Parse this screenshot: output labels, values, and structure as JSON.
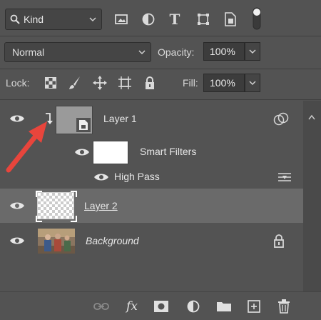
{
  "filter": {
    "kind_label": "Kind",
    "icons": [
      "pixel-filter-icon",
      "adjustment-filter-icon",
      "type-filter-icon",
      "shape-filter-icon",
      "smart-object-filter-icon",
      "filter-toggle-icon"
    ]
  },
  "blend": {
    "mode": "Normal",
    "opacity_label": "Opacity:",
    "opacity_value": "100%"
  },
  "lock": {
    "label": "Lock:",
    "fill_label": "Fill:",
    "fill_value": "100%"
  },
  "layers": [
    {
      "name": "Layer 1",
      "type": "smart-object",
      "clipped": true,
      "visible": true
    },
    {
      "name": "Smart Filters",
      "type": "smart-filters",
      "visible": true
    },
    {
      "name": "High Pass",
      "type": "filter",
      "visible": true
    },
    {
      "name": "Layer 2",
      "type": "transparent",
      "visible": true,
      "selected": true
    },
    {
      "name": "Background",
      "type": "photo",
      "visible": true,
      "locked": true
    }
  ],
  "footer_icons": [
    "link-layers-icon",
    "fx-icon",
    "add-mask-icon",
    "adjustment-layer-icon",
    "new-group-icon",
    "new-layer-icon",
    "trash-icon"
  ],
  "colors": {
    "panel": "#535353",
    "selected_row": "#6a6a6a",
    "arrow": "#e8453c"
  }
}
